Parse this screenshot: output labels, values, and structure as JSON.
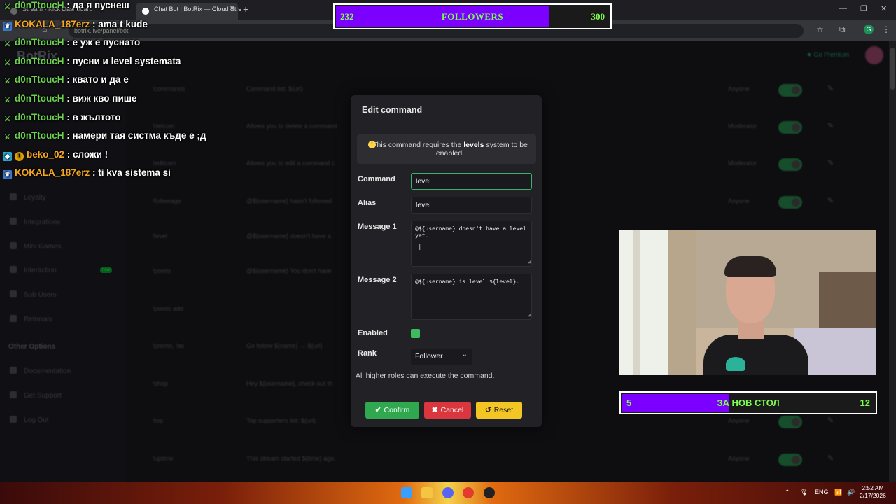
{
  "browser": {
    "tabs": [
      {
        "label": "Stream - Kick Dashboard"
      },
      {
        "label": "Chat Bot | BotRix — Cloud Stre"
      }
    ],
    "new_tab": "+",
    "url": "botrix.live/panel/bot",
    "profile_initial": "G"
  },
  "app": {
    "logo": "BotRix",
    "premium": "Go Premium",
    "sidebar": {
      "items": [
        "Loyalty",
        "Integrations",
        "Mini Games",
        "Interaction",
        "Sub Users",
        "Referrals"
      ],
      "interaction_badge": "new",
      "other_heading": "Other Options",
      "other_items": [
        "Documentation",
        "Get Support",
        "Log Out"
      ]
    },
    "rows": [
      {
        "cmd": "!commands",
        "desc": "Command list: ${url}",
        "rank": "Anyone"
      },
      {
        "cmd": "!delcom",
        "desc": "Allows you to delete a command",
        "rank": "Moderator"
      },
      {
        "cmd": "!editcom",
        "desc": "Allows you to edit a command c",
        "rank": "Moderator"
      },
      {
        "cmd": "!followage",
        "desc": "@${username} hasn't followed",
        "rank": "Anyone"
      },
      {
        "cmd": "!level",
        "desc": "@${username} doesn't have a",
        "rank": ""
      },
      {
        "cmd": "!points",
        "desc": "@${username} You don't have",
        "rank": ""
      },
      {
        "cmd": "!points add",
        "desc": "",
        "rank": ""
      },
      {
        "cmd": "!promo, !as",
        "desc": "Go follow ${name} → ${url}",
        "rank": ""
      },
      {
        "cmd": "!shop",
        "desc": "Hey ${username}, check out th",
        "rank": "Anyone"
      },
      {
        "cmd": "!top",
        "desc": "Top supporters list: ${url}",
        "rank": "Anyone"
      },
      {
        "cmd": "!uptime",
        "desc": "This stream started ${time} ago.",
        "rank": "Anyone"
      }
    ]
  },
  "chat": [
    {
      "user": "d0nTtoucH",
      "msg": "да я пуснеш",
      "color": "green",
      "badges": [
        "sword"
      ]
    },
    {
      "user": "KOKALA_187erz",
      "msg": "ama t kude",
      "color": "orange",
      "badges": [
        "prime"
      ]
    },
    {
      "user": "d0nTtoucH",
      "msg": "е уж е пуснато",
      "color": "green",
      "badges": [
        "sword"
      ]
    },
    {
      "user": "d0nTtoucH",
      "msg": "пусни и level systemata",
      "color": "green",
      "badges": [
        "sword"
      ]
    },
    {
      "user": "d0nTtoucH",
      "msg": "квато и да е",
      "color": "green",
      "badges": [
        "sword"
      ]
    },
    {
      "user": "d0nTtoucH",
      "msg": "виж кво пише",
      "color": "green",
      "badges": [
        "sword"
      ]
    },
    {
      "user": "d0nTtoucH",
      "msg": "в жълтото",
      "color": "green",
      "badges": [
        "sword"
      ]
    },
    {
      "user": "d0nTtoucH",
      "msg": "намери тая систма къде е ;д",
      "color": "green",
      "badges": [
        "sword"
      ]
    },
    {
      "user": "beko_02",
      "msg": "сложи !",
      "color": "orange",
      "badges": [
        "gem",
        "gold"
      ]
    },
    {
      "user": "KOKALA_187erz",
      "msg": "ti kva sistema si",
      "color": "orange",
      "badges": [
        "prime"
      ]
    }
  ],
  "follower_goal": {
    "current": "232",
    "label": "FOLLOWERS",
    "target": "300",
    "progress": 0.773
  },
  "table_goal": {
    "current": "5",
    "label": "ЗА НОВ СТОЛ",
    "target": "12",
    "progress": 0.417
  },
  "modal": {
    "title": "Edit command",
    "notice_pre": "This command requires the",
    "notice_bold": "levels",
    "notice_post": "system to be enabled.",
    "command_label": "Command",
    "command_value": "level",
    "alias_label": "Alias",
    "alias_value": "level",
    "message1_label": "Message 1",
    "message1_value": "@${username} doesn't have a level yet.",
    "message2_label": "Message 2",
    "message2_value": "@${username} is level ${level}.",
    "enabled_label": "Enabled",
    "enabled": true,
    "rank_label": "Rank",
    "rank_value": "Follower",
    "hint": "All higher roles can execute the command.",
    "confirm": "Confirm",
    "cancel": "Cancel",
    "reset": "Reset"
  },
  "taskbar": {
    "lang": "ENG",
    "time": "2:52 AM",
    "date": "2/17/2026"
  },
  "colors": {
    "accent_green": "#2fa84f",
    "cancel_red": "#d9363e",
    "reset_yellow": "#f3c623",
    "goal_purple": "#7b00ff",
    "goal_text": "#7dff4d"
  }
}
